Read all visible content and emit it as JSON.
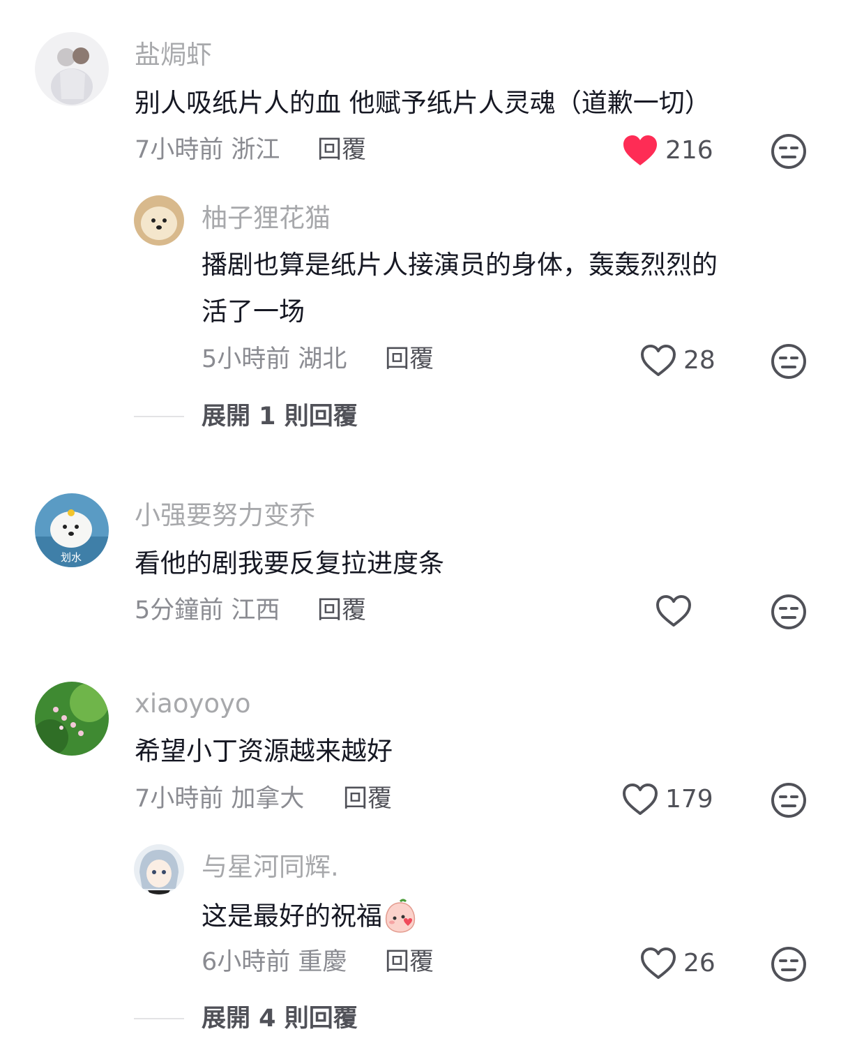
{
  "comments": [
    {
      "username": "盐焗虾",
      "text": "别人吸纸片人的血 他赋予纸片人灵魂（道歉一切）",
      "time": "7小時前",
      "location": "浙江",
      "reply_label": "回覆",
      "likes": "216",
      "liked": true,
      "replies": [
        {
          "username": "柚子狸花猫",
          "text_lines": [
            "播剧也算是纸片人接演员的身体，轰轰烈烈的",
            "活了一场"
          ],
          "time": "5小時前",
          "location": "湖北",
          "reply_label": "回覆",
          "likes": "28"
        }
      ],
      "expand_label": "展開 1 則回覆"
    },
    {
      "username": "小强要努力变乔",
      "avatar_text": "划水",
      "text": "看他的剧我要反复拉进度条",
      "time": "5分鐘前",
      "location": "江西",
      "reply_label": "回覆",
      "likes": ""
    },
    {
      "username": "xiaoyoyo",
      "text": "希望小丁资源越来越好",
      "time": "7小時前",
      "location": "加拿大",
      "reply_label": "回覆",
      "likes": "179",
      "replies": [
        {
          "username": "与星河同辉.",
          "text": "这是最好的祝福",
          "emoji": "blush-peach-emoji",
          "time": "6小時前",
          "location": "重慶",
          "reply_label": "回覆",
          "likes": "26"
        }
      ],
      "expand_label": "展開 4 則回覆"
    }
  ],
  "colors": {
    "liked_heart": "#fe2c55",
    "username": "#a7a8ab",
    "meta": "#8a8b91"
  }
}
